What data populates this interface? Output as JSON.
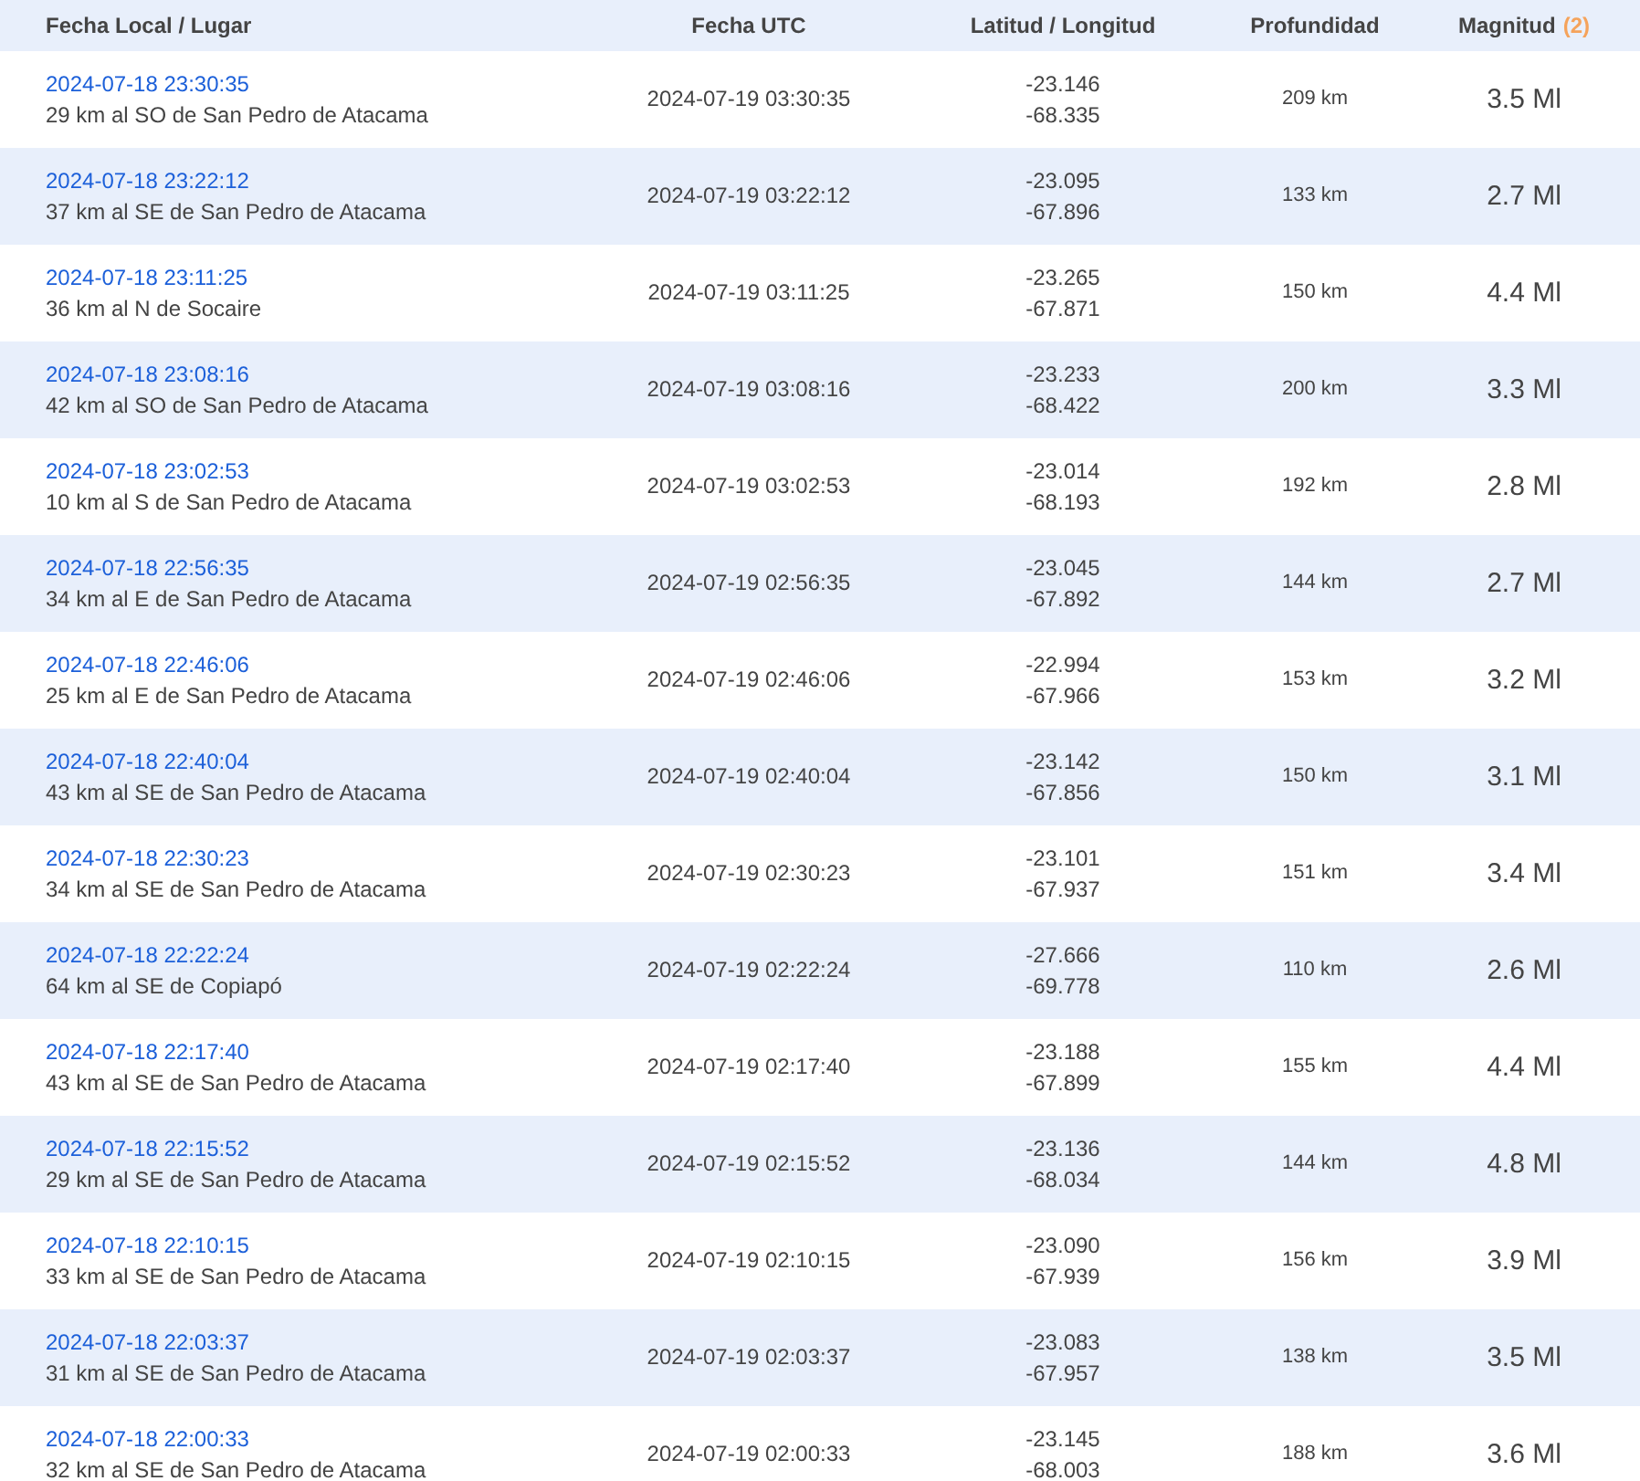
{
  "table": {
    "columns": [
      "Fecha Local / Lugar",
      "Fecha UTC",
      "Latitud / Longitud",
      "Profundidad",
      "Magnitud"
    ],
    "magnitude_count": "(2)",
    "rows": [
      {
        "local": "2024-07-18 23:30:35",
        "place": "29 km al SO de San Pedro de Atacama",
        "utc": "2024-07-19 03:30:35",
        "lat": "-23.146",
        "lon": "-68.335",
        "depth": "209 km",
        "mag": "3.5 Ml"
      },
      {
        "local": "2024-07-18 23:22:12",
        "place": "37 km al SE de San Pedro de Atacama",
        "utc": "2024-07-19 03:22:12",
        "lat": "-23.095",
        "lon": "-67.896",
        "depth": "133 km",
        "mag": "2.7 Ml"
      },
      {
        "local": "2024-07-18 23:11:25",
        "place": "36 km al N de Socaire",
        "utc": "2024-07-19 03:11:25",
        "lat": "-23.265",
        "lon": "-67.871",
        "depth": "150 km",
        "mag": "4.4 Ml"
      },
      {
        "local": "2024-07-18 23:08:16",
        "place": "42 km al SO de San Pedro de Atacama",
        "utc": "2024-07-19 03:08:16",
        "lat": "-23.233",
        "lon": "-68.422",
        "depth": "200 km",
        "mag": "3.3 Ml"
      },
      {
        "local": "2024-07-18 23:02:53",
        "place": "10 km al S de San Pedro de Atacama",
        "utc": "2024-07-19 03:02:53",
        "lat": "-23.014",
        "lon": "-68.193",
        "depth": "192 km",
        "mag": "2.8 Ml"
      },
      {
        "local": "2024-07-18 22:56:35",
        "place": "34 km al E de San Pedro de Atacama",
        "utc": "2024-07-19 02:56:35",
        "lat": "-23.045",
        "lon": "-67.892",
        "depth": "144 km",
        "mag": "2.7 Ml"
      },
      {
        "local": "2024-07-18 22:46:06",
        "place": "25 km al E de San Pedro de Atacama",
        "utc": "2024-07-19 02:46:06",
        "lat": "-22.994",
        "lon": "-67.966",
        "depth": "153 km",
        "mag": "3.2 Ml"
      },
      {
        "local": "2024-07-18 22:40:04",
        "place": "43 km al SE de San Pedro de Atacama",
        "utc": "2024-07-19 02:40:04",
        "lat": "-23.142",
        "lon": "-67.856",
        "depth": "150 km",
        "mag": "3.1 Ml"
      },
      {
        "local": "2024-07-18 22:30:23",
        "place": "34 km al SE de San Pedro de Atacama",
        "utc": "2024-07-19 02:30:23",
        "lat": "-23.101",
        "lon": "-67.937",
        "depth": "151 km",
        "mag": "3.4 Ml"
      },
      {
        "local": "2024-07-18 22:22:24",
        "place": "64 km al SE de Copiapó",
        "utc": "2024-07-19 02:22:24",
        "lat": "-27.666",
        "lon": "-69.778",
        "depth": "110 km",
        "mag": "2.6 Ml"
      },
      {
        "local": "2024-07-18 22:17:40",
        "place": "43 km al SE de San Pedro de Atacama",
        "utc": "2024-07-19 02:17:40",
        "lat": "-23.188",
        "lon": "-67.899",
        "depth": "155 km",
        "mag": "4.4 Ml"
      },
      {
        "local": "2024-07-18 22:15:52",
        "place": "29 km al SE de San Pedro de Atacama",
        "utc": "2024-07-19 02:15:52",
        "lat": "-23.136",
        "lon": "-68.034",
        "depth": "144 km",
        "mag": "4.8 Ml"
      },
      {
        "local": "2024-07-18 22:10:15",
        "place": "33 km al SE de San Pedro de Atacama",
        "utc": "2024-07-19 02:10:15",
        "lat": "-23.090",
        "lon": "-67.939",
        "depth": "156 km",
        "mag": "3.9 Ml"
      },
      {
        "local": "2024-07-18 22:03:37",
        "place": "31 km al SE de San Pedro de Atacama",
        "utc": "2024-07-19 02:03:37",
        "lat": "-23.083",
        "lon": "-67.957",
        "depth": "138 km",
        "mag": "3.5 Ml"
      },
      {
        "local": "2024-07-18 22:00:33",
        "place": "32 km al SE de San Pedro de Atacama",
        "utc": "2024-07-19 02:00:33",
        "lat": "-23.145",
        "lon": "-68.003",
        "depth": "188 km",
        "mag": "3.6 Ml"
      }
    ]
  }
}
